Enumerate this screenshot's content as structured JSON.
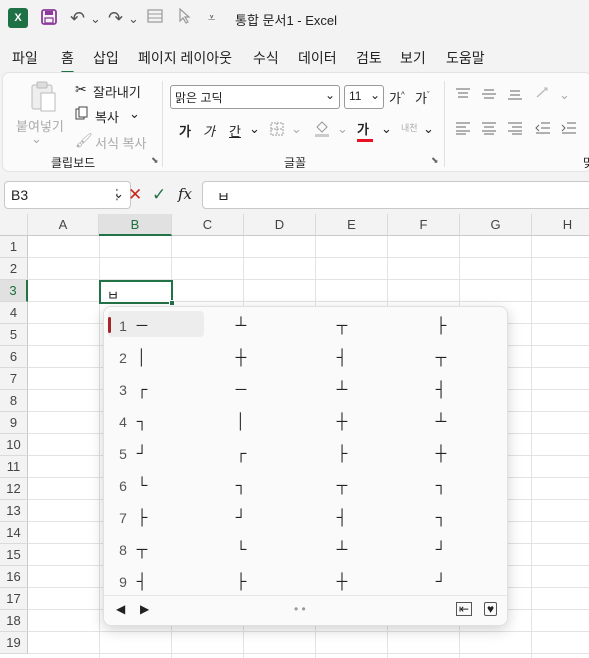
{
  "titlebar": {
    "title": "통합 문서1  -  Excel",
    "icons": [
      "excel-logo",
      "save-icon",
      "undo-icon",
      "redo-icon",
      "form-icon",
      "pointer-icon",
      "customize-icon"
    ],
    "excel_letter": "X",
    "undo": "↶",
    "redo": "↷",
    "customize": "⩡",
    "dropdown": "⌄"
  },
  "menu": {
    "items": [
      "파일",
      "홈",
      "삽입",
      "페이지 레이아웃",
      "수식",
      "데이터",
      "검토",
      "보기",
      "도움말"
    ],
    "active": "홈"
  },
  "ribbon": {
    "clipboard": {
      "paste": "붙여넣기",
      "cut": "잘라내기",
      "copy": "복사",
      "format_painter": "서식 복사",
      "label": "클립보드",
      "caret": "⌄"
    },
    "font": {
      "font_name": "맑은 고딕",
      "font_size": "11",
      "grow": "가",
      "shrink": "가",
      "bold": "가",
      "italic": "가",
      "underline": "간",
      "color_letter": "가",
      "phonetic": "내천",
      "label": "글꼴",
      "caret": "⌄",
      "color_underline": "#e81123"
    },
    "third_label": "맞"
  },
  "formula": {
    "name_box": "B3",
    "cancel": "✕",
    "enter": "✓",
    "fx": "fx",
    "content": "ㅂ",
    "more": "⋮"
  },
  "sheet": {
    "columns": [
      "A",
      "B",
      "C",
      "D",
      "E",
      "F",
      "G",
      "H"
    ],
    "rows": [
      "1",
      "2",
      "3",
      "4",
      "5",
      "6",
      "7",
      "8",
      "9",
      "10",
      "11",
      "12",
      "13",
      "14",
      "15",
      "16",
      "17",
      "18",
      "19"
    ],
    "selected_column": "B",
    "selected_row": "3",
    "active_cell_value": "ㅂ"
  },
  "ime": {
    "numbers": [
      "1",
      "2",
      "3",
      "4",
      "5",
      "6",
      "7",
      "8",
      "9"
    ],
    "column1": [
      "─",
      "│",
      "┌",
      "┐",
      "┘",
      "└",
      "├",
      "┬",
      "┤"
    ],
    "column2": [
      "┴",
      "┼",
      "─",
      "│",
      "┌",
      "┐",
      "┘",
      "└",
      "├"
    ],
    "column3": [
      "┬",
      "┤",
      "┴",
      "┼",
      "├",
      "┬",
      "┤",
      "┴",
      "┼"
    ],
    "column4": [
      "├",
      "┬",
      "┤",
      "┴",
      "┼",
      "┐",
      "┐",
      "┘",
      "┘"
    ],
    "prev": "◀",
    "next": "▶",
    "page_dots": "• •",
    "expand": "⇤",
    "favorite": "♥"
  },
  "colors": {
    "accent": "#217346",
    "ime_accent": "#a4262c",
    "save": "#8b3a9c"
  }
}
